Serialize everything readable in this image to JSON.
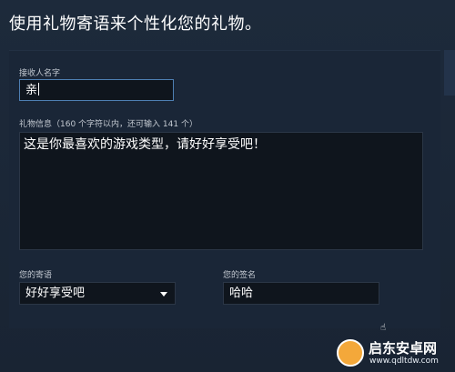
{
  "page": {
    "title": "使用礼物寄语来个性化您的礼物。"
  },
  "form": {
    "recipient_label": "接收人名字",
    "recipient_value": "亲",
    "message_label": "礼物信息（160 个字符以内，还可输入 141 个）",
    "message_value": "这是你最喜欢的游戏类型，请好好享受吧！",
    "sentiment_label": "您的寄语",
    "sentiment_value": "好好享受吧",
    "signature_label": "您的签名",
    "signature_value": "哈哈"
  },
  "watermark": {
    "title": "启东安卓网",
    "url": "www.qdltdw.com"
  },
  "colors": {
    "background": "#1b2738",
    "panel": "#1a2637",
    "input_bg": "#0f151d",
    "focus_border": "#4e7fb3"
  }
}
